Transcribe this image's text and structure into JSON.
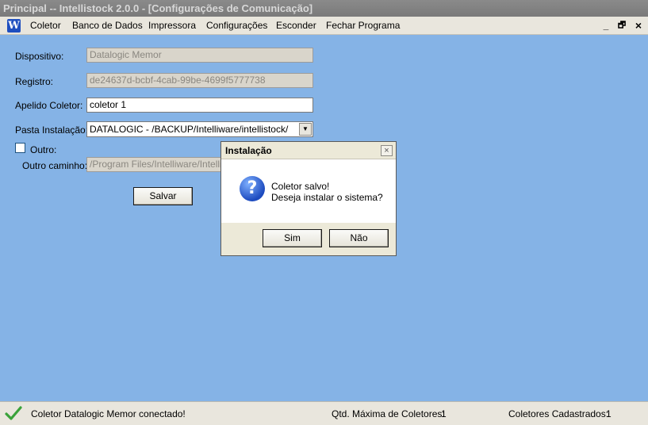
{
  "window": {
    "title": "Principal -- Intellistock 2.0.0 - [Configurações de Comunicação]"
  },
  "menu": {
    "app_icon": "W",
    "items": [
      "Coletor",
      "Banco de Dados",
      "Impressora",
      "Configurações",
      "Esconder",
      "Fechar Programa"
    ],
    "controls": {
      "minimize": "_",
      "restore": "🗗",
      "close": "×"
    }
  },
  "form": {
    "dispositivo": {
      "label": "Dispositivo:",
      "value": "Datalogic Memor"
    },
    "registro": {
      "label": "Registro:",
      "value": "de24637d-bcbf-4cab-99be-4699f5777738"
    },
    "apelido": {
      "label": "Apelido Coletor:",
      "value": "coletor 1"
    },
    "pasta": {
      "label": "Pasta Instalação:",
      "value": "DATALOGIC - /BACKUP/Intelliware/intellistock/"
    },
    "outro": {
      "label": "Outro:",
      "checked": false
    },
    "outro_caminho": {
      "label": "Outro caminho:",
      "value": "/Program Files/Intelliware/IntelliSto"
    },
    "save_label": "Salvar"
  },
  "dialog": {
    "title": "Instalação",
    "close_glyph": "×",
    "icon": "?",
    "line1": "Coletor salvo!",
    "line2": "Deseja instalar o sistema?",
    "yes_label": "Sim",
    "no_label": "Não"
  },
  "status": {
    "message": "Coletor Datalogic Memor conectado!",
    "max_label": "Qtd. Máxima de Coletores:",
    "max_value": "1",
    "registered_label": "Coletores Cadastrados:",
    "registered_value": "1"
  },
  "colors": {
    "client_bg": "#85b3e6",
    "status_ok": "#3aa23a",
    "question_icon": "#1d4bbf"
  }
}
